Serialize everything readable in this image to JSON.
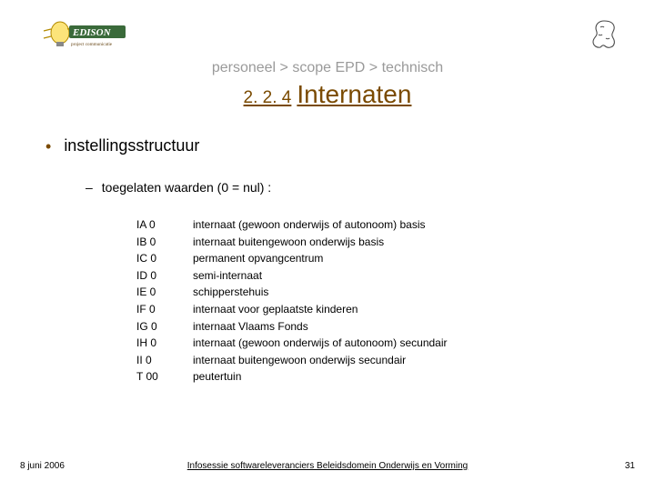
{
  "breadcrumb": "personeel > scope EPD > technisch",
  "title": {
    "number": "2. 2. 4",
    "text": "Internaten"
  },
  "bullet_l1": "instellingsstructuur",
  "bullet_l2": "toegelaten waarden (0 = nul) :",
  "values": [
    {
      "code": "IA 0",
      "desc": "internaat (gewoon onderwijs of autonoom) basis"
    },
    {
      "code": "IB 0",
      "desc": "internaat buitengewoon onderwijs basis"
    },
    {
      "code": "IC 0",
      "desc": "permanent opvangcentrum"
    },
    {
      "code": "ID 0",
      "desc": "semi-internaat"
    },
    {
      "code": "IE 0",
      "desc": "schipperstehuis"
    },
    {
      "code": "IF 0",
      "desc": "internaat voor geplaatste kinderen"
    },
    {
      "code": "IG 0",
      "desc": "internaat Vlaams Fonds"
    },
    {
      "code": "IH 0",
      "desc": "internaat (gewoon onderwijs of autonoom) secundair"
    },
    {
      "code": "II 0",
      "desc": "internaat buitengewoon onderwijs secundair"
    },
    {
      "code": "T 00",
      "desc": "peutertuin"
    }
  ],
  "footer": {
    "date": "8 juni 2006",
    "text": "Infosessie softwareleveranciers Beleidsdomein Onderwijs en Vorming",
    "page": "31"
  },
  "logo": {
    "left_name": "Edison project communicatie",
    "right_name": "Vlaamse overheid"
  }
}
